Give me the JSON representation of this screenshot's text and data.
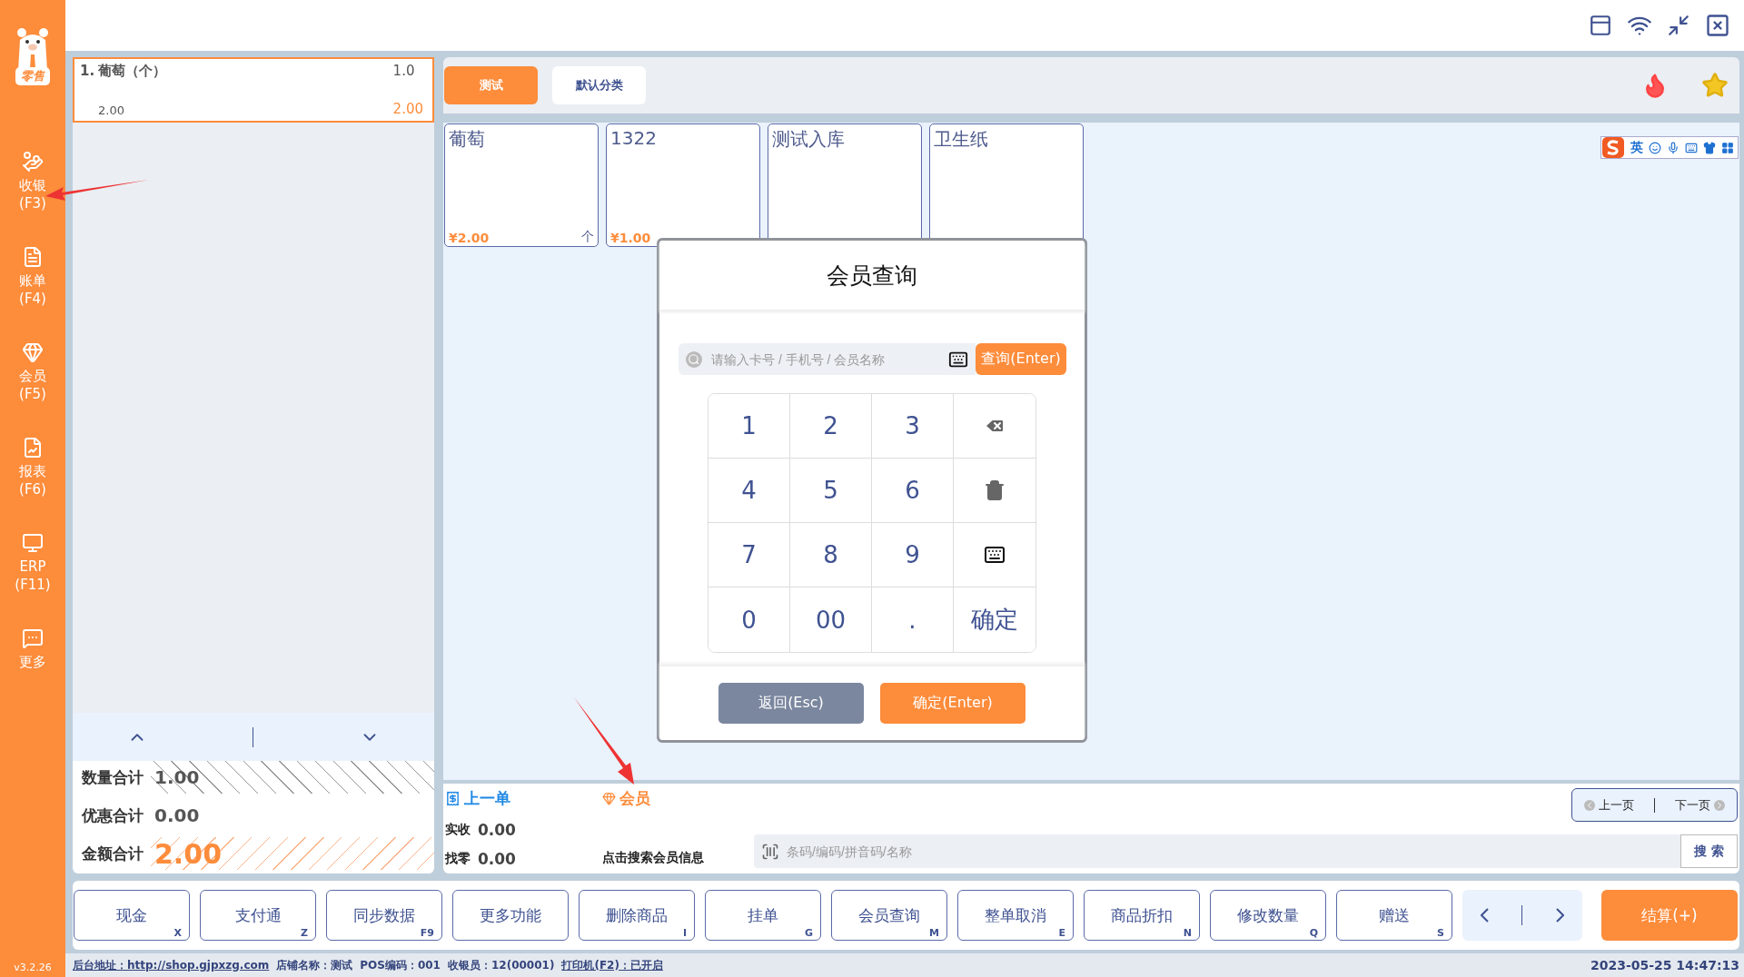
{
  "sidebar": {
    "logo_text": "零售",
    "items": [
      {
        "label": "收银",
        "key": "(F3)"
      },
      {
        "label": "账单",
        "key": "(F4)"
      },
      {
        "label": "会员",
        "key": "(F5)"
      },
      {
        "label": "报表",
        "key": "(F6)"
      },
      {
        "label": "ERP",
        "key": "(F11)"
      },
      {
        "label": "更多"
      }
    ],
    "version": "v3.2.26"
  },
  "cart": {
    "items": [
      {
        "index": "1.",
        "name": "葡萄（个）",
        "qty": "1.0",
        "price": "2.00",
        "amount": "2.00",
        "selected": true
      }
    ]
  },
  "totals": [
    {
      "label": "数量合计",
      "value": "1.00",
      "kind": "hatched"
    },
    {
      "label": "优惠合计",
      "value": "0.00",
      "kind": "plain"
    },
    {
      "label": "金额合计",
      "value": "2.00",
      "kind": "highlight"
    }
  ],
  "categories": [
    {
      "label": "测试",
      "selected": true
    },
    {
      "label": "默认分类",
      "selected": false
    }
  ],
  "products": [
    {
      "name": "葡萄",
      "price": "¥2.00",
      "unit": "个"
    },
    {
      "name": "1322",
      "price": "¥1.00"
    },
    {
      "name": "测试入库"
    },
    {
      "name": "卫生纸"
    }
  ],
  "ime": {
    "mode": "英"
  },
  "dialog": {
    "title": "会员查询",
    "search_placeholder": "请输入卡号 / 手机号 / 会员名称",
    "query_button": "查询(Enter)",
    "keypad": [
      {
        "kind": "key",
        "label": "1"
      },
      {
        "kind": "key",
        "label": "2"
      },
      {
        "kind": "key",
        "label": "3"
      },
      {
        "kind": "backspace"
      },
      {
        "kind": "key",
        "label": "4"
      },
      {
        "kind": "key",
        "label": "5"
      },
      {
        "kind": "key",
        "label": "6"
      },
      {
        "kind": "clear"
      },
      {
        "kind": "key",
        "label": "7"
      },
      {
        "kind": "key",
        "label": "8"
      },
      {
        "kind": "key",
        "label": "9"
      },
      {
        "kind": "keyboard"
      },
      {
        "kind": "key",
        "label": "0"
      },
      {
        "kind": "key",
        "label": "00"
      },
      {
        "kind": "key",
        "label": "."
      },
      {
        "kind": "key",
        "label": "确定"
      }
    ],
    "buttons": [
      {
        "label": "返回(Esc)",
        "kind": "secondary"
      },
      {
        "label": "确定(Enter)",
        "kind": "primary"
      }
    ]
  },
  "info": {
    "last_order": "上一单",
    "member": "会员",
    "received": {
      "label": "实收",
      "value": "0.00"
    },
    "change": {
      "label": "找零",
      "value": "0.00"
    },
    "member_hint": "点击搜索会员信息",
    "search_placeholder": "条码/编码/拼音码/名称",
    "search_button": "搜 索",
    "pager": [
      "上一页",
      "下一页"
    ]
  },
  "functions": [
    {
      "label": "现金",
      "key": "X"
    },
    {
      "label": "支付通",
      "key": "Z"
    },
    {
      "label": "同步数据",
      "key": "F9"
    },
    {
      "label": "更多功能"
    },
    {
      "label": "删除商品",
      "key": "I"
    },
    {
      "label": "挂单",
      "key": "G"
    },
    {
      "label": "会员查询",
      "key": "M"
    },
    {
      "label": "整单取消",
      "key": "E"
    },
    {
      "label": "商品折扣",
      "key": "N"
    },
    {
      "label": "修改数量",
      "key": "Q"
    },
    {
      "label": "赠送",
      "key": "S"
    }
  ],
  "checkout": "结算(+)",
  "status_bar": {
    "items": [
      {
        "text": "后台地址：http://shop.gjpxzg.com",
        "link": true
      },
      {
        "text": "店铺名称：测试",
        "link": false
      },
      {
        "text": "POS编码：001",
        "link": false
      },
      {
        "text": "收银员：12(00001)",
        "link": false
      },
      {
        "text": "打印机(F2)：已开启",
        "link": true
      }
    ],
    "datetime": "2023-05-25 14:47:13"
  }
}
